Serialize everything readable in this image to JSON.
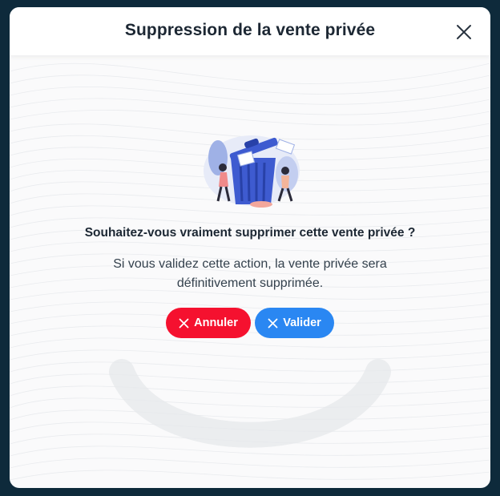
{
  "modal": {
    "title": "Suppression de la vente privée",
    "question": "Souhaitez-vous vraiment supprimer cette vente privée ?",
    "description": "Si vous validez cette action, la vente privée sera définitivement supprimée.",
    "cancel_label": "Annuler",
    "validate_label": "Valider",
    "icons": {
      "close": "close-icon",
      "cancel": "x-icon",
      "validate": "x-icon",
      "illustration": "trash-can-illustration"
    },
    "colors": {
      "cancel": "#f5112f",
      "validate": "#2a87f2",
      "backdrop": "#0e2a3b"
    }
  }
}
